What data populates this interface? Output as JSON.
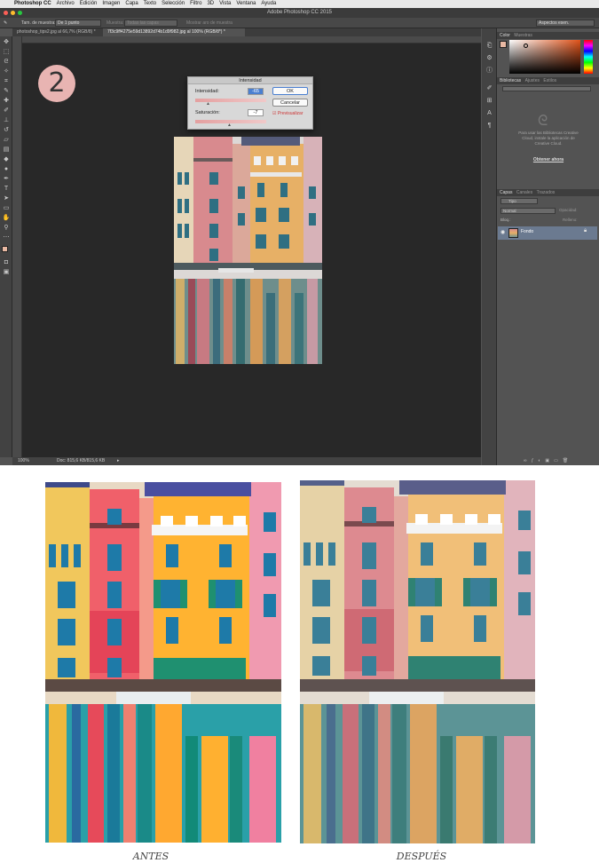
{
  "menubar": {
    "app": "Photoshop CC",
    "items": [
      "Archivo",
      "Edición",
      "Imagen",
      "Capa",
      "Texto",
      "Selección",
      "Filtro",
      "3D",
      "Vista",
      "Ventana",
      "Ayuda"
    ]
  },
  "window_title": "Adobe Photoshop CC 2015",
  "options_bar": {
    "sample_size_label": "Tam. de muestra:",
    "sample_size_value": "De 1 punto",
    "sample_label": "Muestra:",
    "sample_value": "Todas las capas",
    "ring_label": "Mostrar aro de muestra",
    "workspace": "Aspectos esen."
  },
  "tabs": [
    {
      "label": "photoshop_tips2.jpg al 66,7% (RGB/8) *"
    },
    {
      "label": "7f3c9ff4275e59d13892d74b1d9f982.jpg al 100% (RGB/8*) *"
    }
  ],
  "step_number": "2",
  "dialog": {
    "title": "Intensidad",
    "vibrance_label": "Intensidad:",
    "vibrance_value": "-65",
    "saturation_label": "Saturación:",
    "saturation_value": "-7",
    "ok_label": "OK",
    "cancel_label": "Cancelar",
    "preview_label": "Previsualizar"
  },
  "status_bar": {
    "zoom": "100%",
    "doc": "Doc: 815,6 KB/815,6 KB"
  },
  "panels": {
    "color_tab": "Color",
    "swatches_tab": "Muestras",
    "libraries_tab": "Bibliotecas",
    "adjustments_tab": "Ajustes",
    "styles_tab": "Estilos",
    "libraries_message": "Para usar las Bibliotecas Creative Cloud, instale la aplicación de Creative Cloud.",
    "libraries_link": "Obtener ahora",
    "layers_tab": "Capas",
    "channels_tab": "Canales",
    "paths_tab": "Trazados",
    "kind_filter": "Tipo",
    "blend_mode": "Normal",
    "opacity_label": "Opacidad:",
    "lock_label": "Bloq.:",
    "fill_label": "Relleno:",
    "layer_name": "Fondo"
  },
  "captions": {
    "before": "ANTES",
    "after": "DESPUÉS"
  },
  "colors": {
    "foreground": "#e9b9a3",
    "badge": "#e8b4b2",
    "accent": "#4a6ea0"
  }
}
